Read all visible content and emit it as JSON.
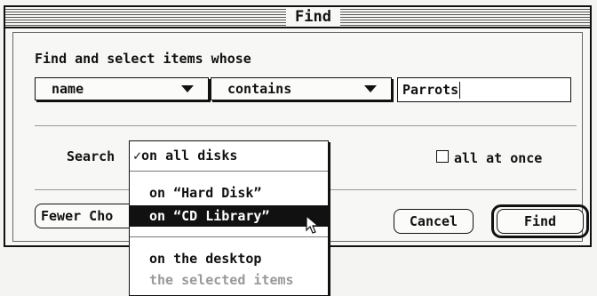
{
  "window": {
    "title": "Find"
  },
  "dialog": {
    "heading": "Find and select items whose",
    "criteria": {
      "attribute": "name",
      "operator": "contains",
      "value": "Parrots"
    },
    "search_label": "Search",
    "search_menu": {
      "items": [
        {
          "label": "on all disks",
          "checked": true,
          "highlighted": false,
          "enabled": true
        },
        {
          "label": "on “Hard Disk”",
          "checked": false,
          "highlighted": false,
          "enabled": true
        },
        {
          "label": "on “CD Library”",
          "checked": false,
          "highlighted": true,
          "enabled": true
        },
        {
          "label": "on the desktop",
          "checked": false,
          "highlighted": false,
          "enabled": true
        },
        {
          "label": "the selected items",
          "checked": false,
          "highlighted": false,
          "enabled": false
        }
      ],
      "check_mark": "✓"
    },
    "all_at_once_label": "all at once",
    "all_at_once_checked": false,
    "fewer_choices_label": "Fewer Cho",
    "cancel_label": "Cancel",
    "find_label": "Find"
  },
  "icons": {
    "cursor": "arrow-cursor-icon",
    "popup": "triangle-down-icon"
  }
}
